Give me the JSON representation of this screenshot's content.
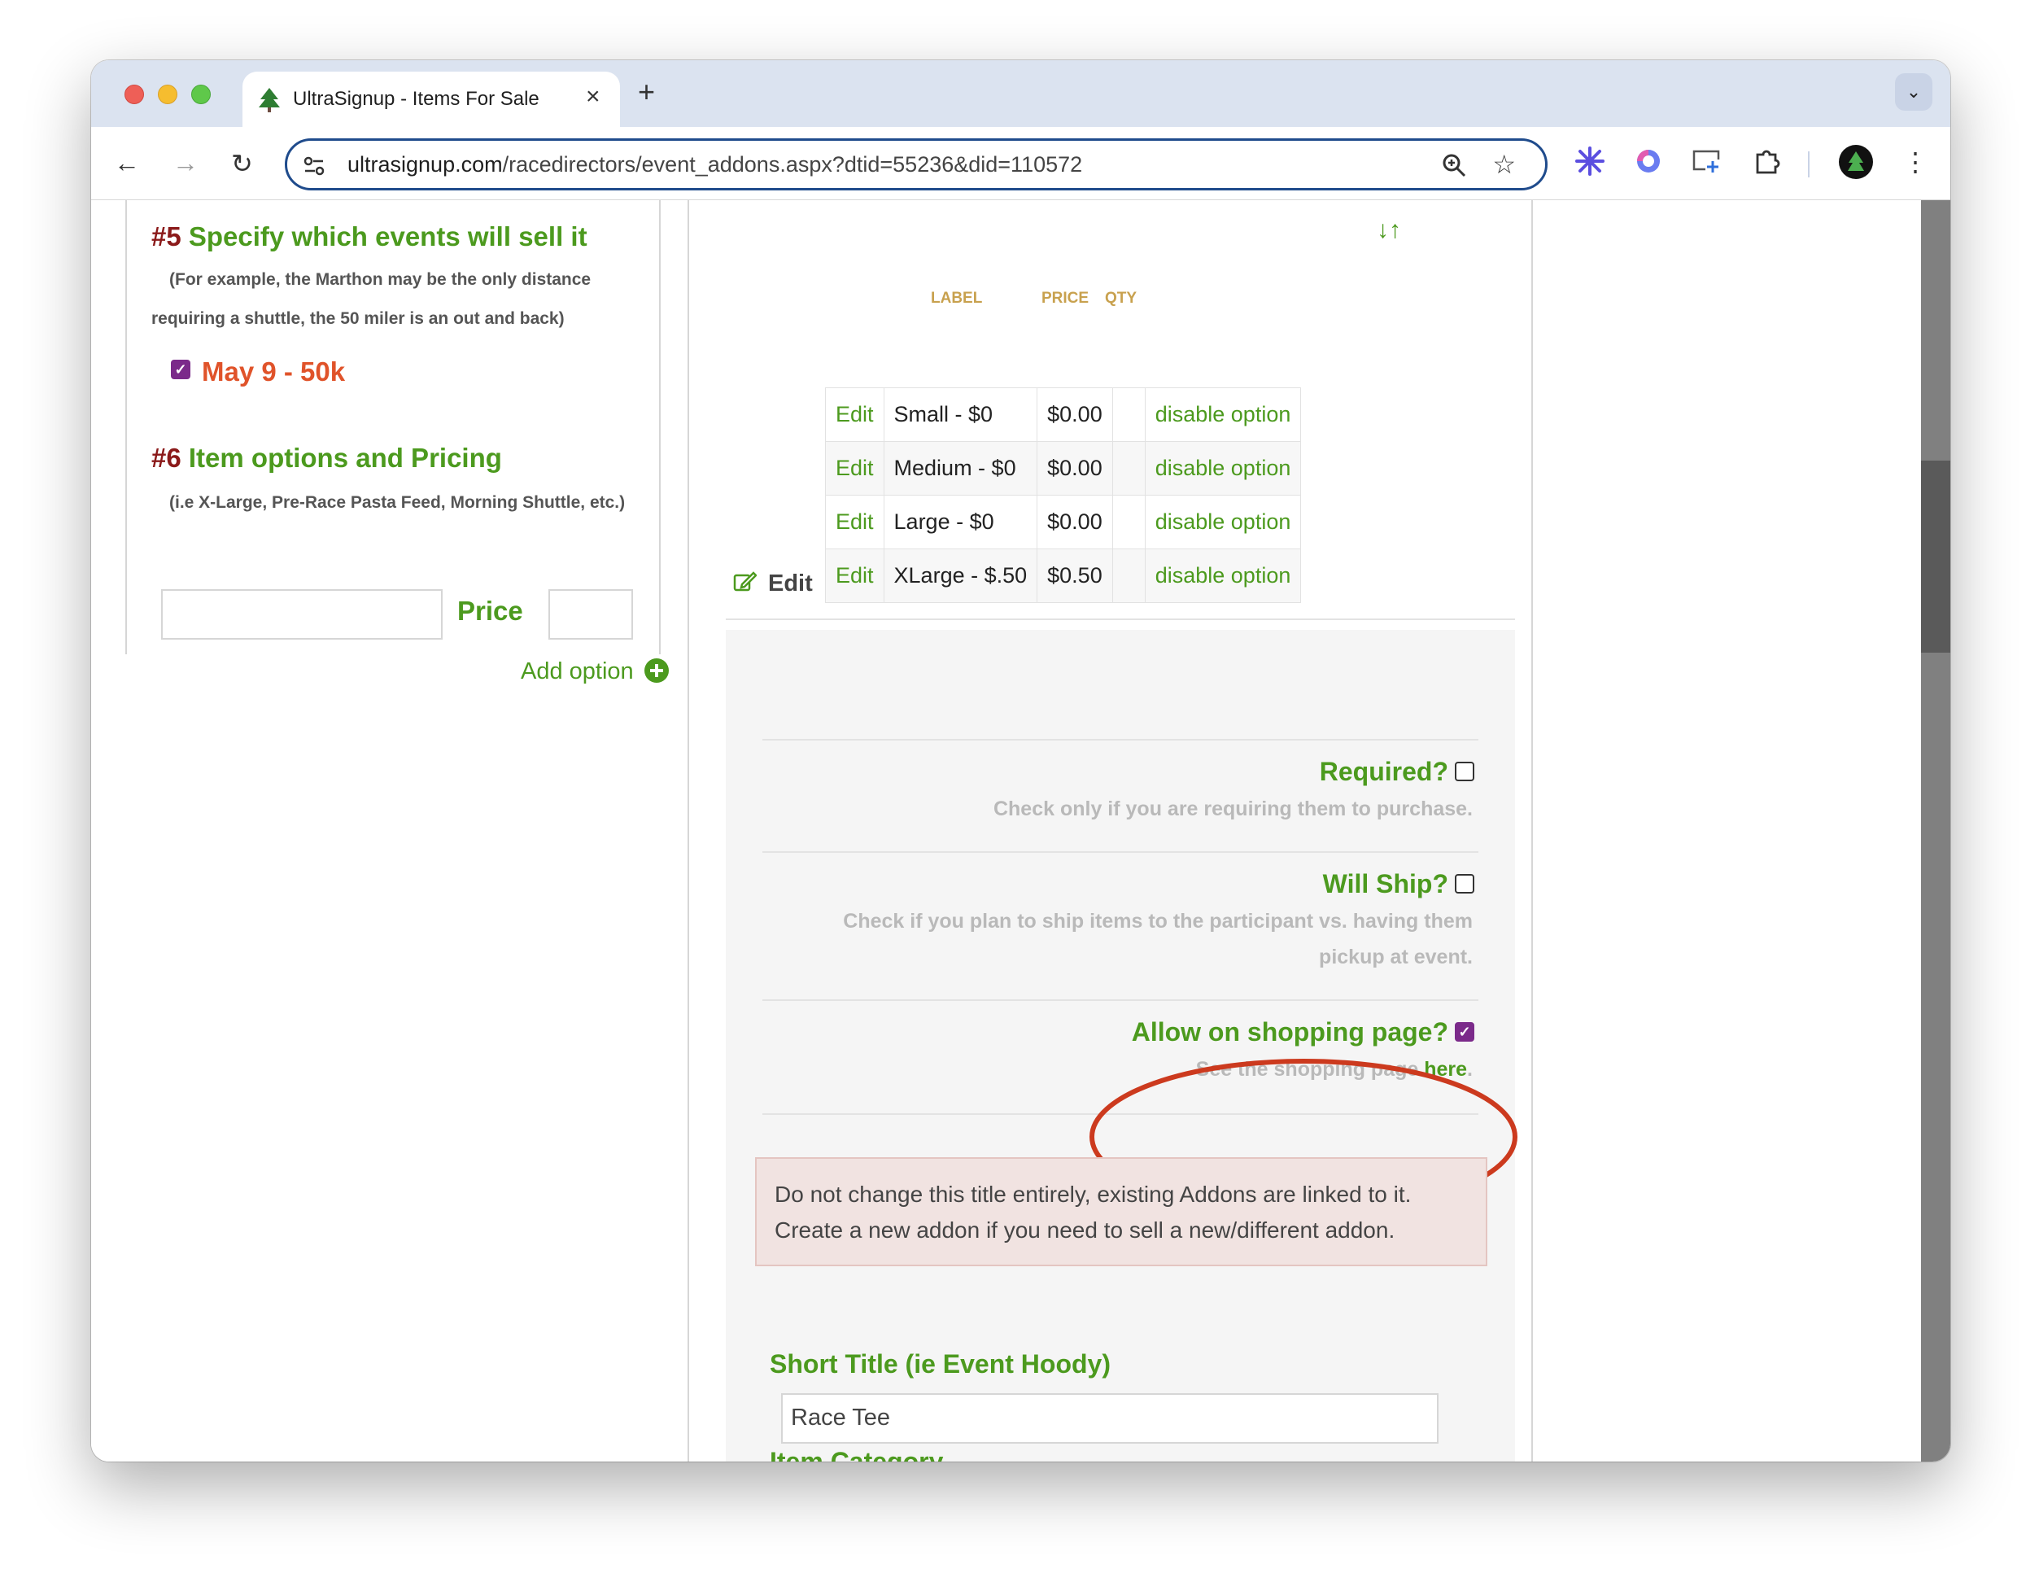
{
  "browser": {
    "tab_title": "UltraSignup - Items For Sale",
    "url_prefix": "ultrasignup.com",
    "url_path": "/racedirectors/event_addons.aspx?dtid=55236&did=110572"
  },
  "left": {
    "section5": {
      "number": "#5",
      "title": "Specify which events will sell it",
      "note_line1": "(For example, the Marthon may be the only distance",
      "note_line2": "requiring a shuttle, the 50 miler is an out and back)",
      "event_label": "May 9 - 50k",
      "event_checked": true
    },
    "section6": {
      "number": "#6",
      "title": "Item options and Pricing",
      "note": "(i.e X-Large, Pre-Race Pasta Feed, Morning Shuttle, etc.)",
      "price_label": "Price",
      "add_option": "Add option"
    }
  },
  "options_table": {
    "headers": {
      "label": "LABEL",
      "price": "PRICE",
      "qty": "QTY"
    },
    "rows": [
      {
        "edit": "Edit",
        "label": "Small - $0",
        "price": "$0.00",
        "qty": "",
        "action": "disable option"
      },
      {
        "edit": "Edit",
        "label": "Medium - $0",
        "price": "$0.00",
        "qty": "",
        "action": "disable option"
      },
      {
        "edit": "Edit",
        "label": "Large - $0",
        "price": "$0.00",
        "qty": "",
        "action": "disable option"
      },
      {
        "edit": "Edit",
        "label": "XLarge - $.50",
        "price": "$0.50",
        "qty": "",
        "action": "disable option"
      }
    ]
  },
  "edit_section": {
    "heading": "Edit",
    "required": {
      "label": "Required?",
      "checked": false,
      "help": "Check only if you are requiring them to purchase."
    },
    "will_ship": {
      "label": "Will Ship?",
      "checked": false,
      "help_line1": "Check if you plan to ship items to the participant vs. having them",
      "help_line2": "pickup at event."
    },
    "shopping": {
      "label": "Allow on shopping page?",
      "checked": true,
      "help_prefix": "See the shopping page ",
      "help_link": "here",
      "help_suffix": "."
    },
    "alert_line1": "Do not change this title entirely, existing Addons are linked to it.",
    "alert_line2": "Create a new addon if you need to sell a new/different addon.",
    "short_title_label": "Short Title (ie Event Hoody)",
    "short_title_value": "Race Tee",
    "category_label": "Item Category"
  },
  "colors": {
    "green": "#4c9a1e",
    "dark_red": "#8b1a1a",
    "orange": "#e0532a",
    "purple": "#7b2a8a",
    "annotation_red": "#cc3a1e"
  }
}
